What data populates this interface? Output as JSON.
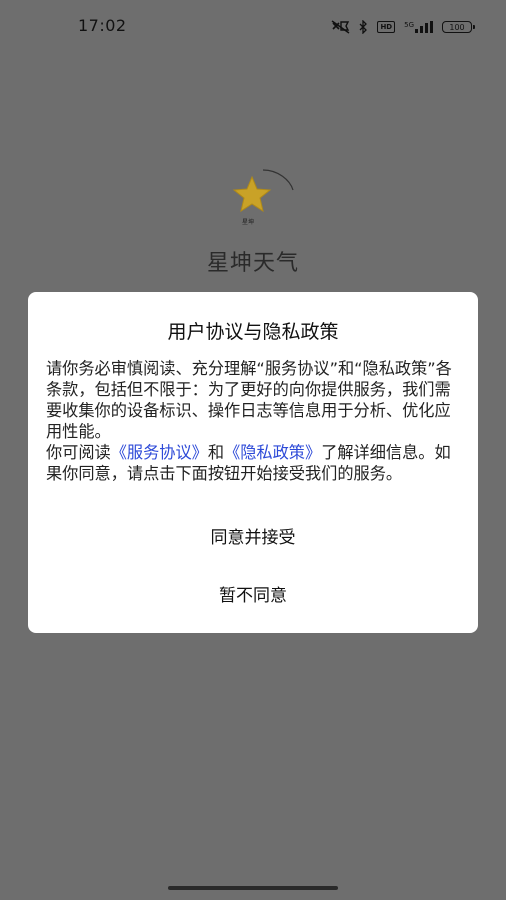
{
  "status_bar": {
    "time": "17:02",
    "icons": [
      "mute-icon",
      "bluetooth-icon",
      "hd-icon",
      "signal-5g-icon",
      "battery-icon"
    ],
    "hd_label": "HD",
    "network_label": "5G",
    "battery_level": "100"
  },
  "splash": {
    "logo_icon": "star-logo-icon",
    "logo_caption": "星坤",
    "app_name": "星坤天气"
  },
  "dialog": {
    "title": "用户协议与隐私政策",
    "paragraph1": "请你务必审慎阅读、充分理解“服务协议”和“隐私政策”各条款，包括但不限于：为了更好的向你提供服务，我们需要收集你的设备标识、操作日志等信息用于分析、优化应用性能。",
    "paragraph2_prefix": "你可阅读",
    "service_link": "《服务协议》",
    "and_text": "和",
    "privacy_link": "《隐私政策》",
    "paragraph2_suffix": "了解详细信息。如果你同意，请点击下面按钮开始接受我们的服务。",
    "agree_label": "同意并接受",
    "disagree_label": "暂不同意"
  },
  "colors": {
    "overlay_bg": "#6e6e6e",
    "link": "#2d4ad8",
    "star": "#c9a227"
  }
}
